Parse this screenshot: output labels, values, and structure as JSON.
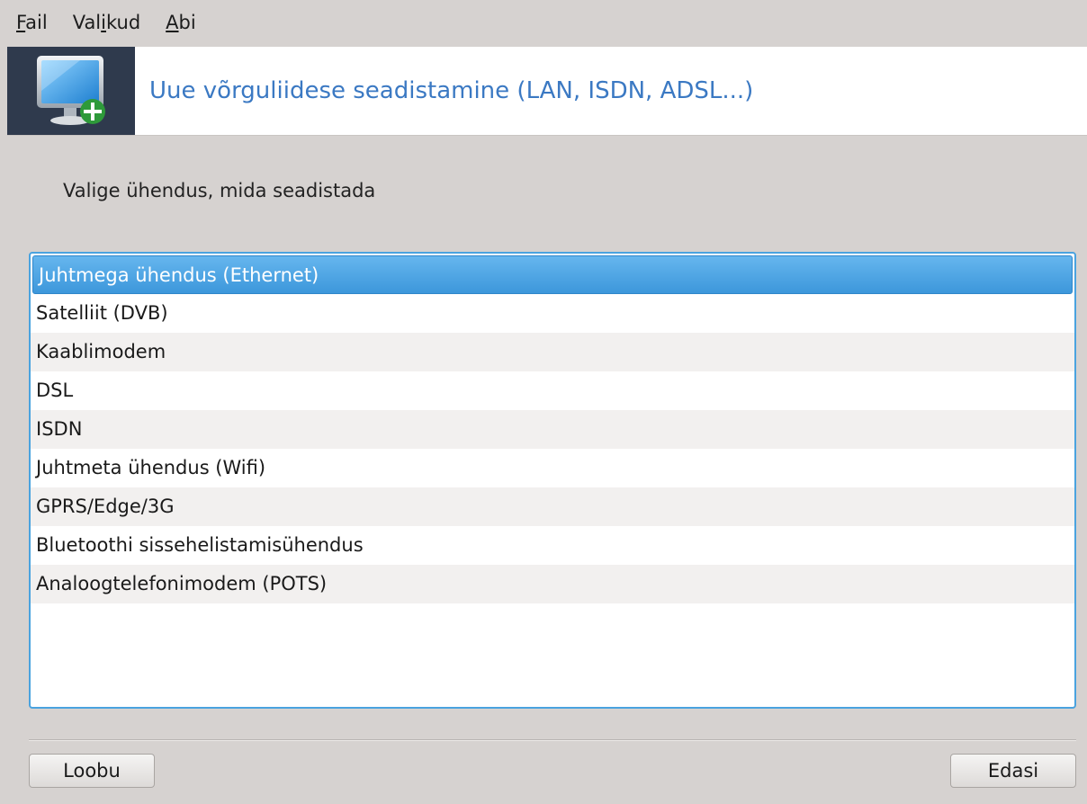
{
  "menubar": {
    "items": [
      {
        "label": "Fail",
        "mnemonic": "F",
        "rest": "ail"
      },
      {
        "label": "Valikud",
        "before": "Val",
        "mnemonic": "i",
        "rest": "kud"
      },
      {
        "label": "Abi",
        "mnemonic": "A",
        "rest": "bi"
      }
    ]
  },
  "header": {
    "title": "Uue võrguliidese seadistamine (LAN, ISDN, ADSL...)",
    "icon": "monitor-add-icon"
  },
  "prompt": "Valige ühendus, mida seadistada",
  "connections": {
    "selected_index": 0,
    "items": [
      "Juhtmega ühendus (Ethernet)",
      "Satelliit (DVB)",
      "Kaablimodem",
      "DSL",
      "ISDN",
      "Juhtmeta ühendus (Wifi)",
      "GPRS/Edge/3G",
      "Bluetoothi sissehelistamisühendus",
      "Analoogtelefonimodem (POTS)"
    ]
  },
  "buttons": {
    "cancel": "Loobu",
    "next": "Edasi"
  },
  "colors": {
    "accent": "#3b79c3",
    "selection": "#4aa3df",
    "header_icon_bg": "#2f3a4d"
  }
}
